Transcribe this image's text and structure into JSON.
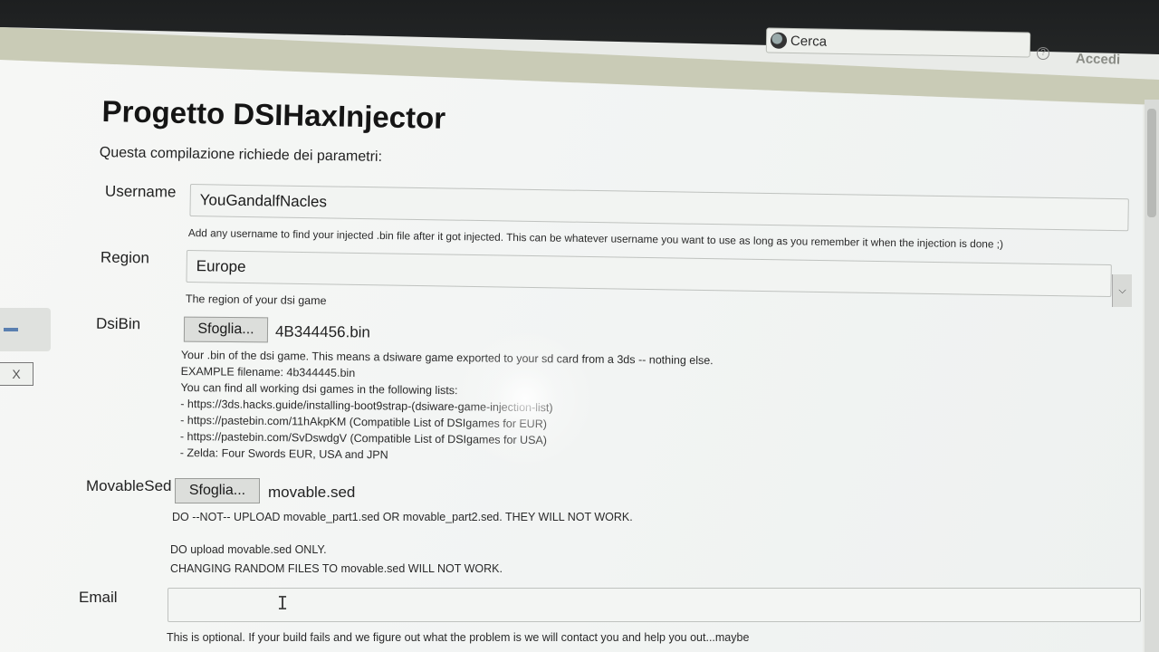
{
  "header": {
    "search_placeholder": "Cerca",
    "help_label": "?",
    "login_label": "Accedi"
  },
  "page": {
    "title": "Progetto DSIHaxInjector",
    "subtitle": "Questa compilazione richiede dei parametri:"
  },
  "form": {
    "username": {
      "label": "Username",
      "value": "YouGandalfNacles",
      "help": "Add any username to find your injected .bin file after it got injected. This can be whatever username you want to use as long as you remember it when the injection is done ;)"
    },
    "region": {
      "label": "Region",
      "value": "Europe",
      "help": "The region of your dsi game"
    },
    "dsibin": {
      "label": "DsiBin",
      "button": "Sfoglia...",
      "filename": "4B344456.bin",
      "help_lines": [
        "Your .bin of the dsi game. This means a dsiware game exported to your sd card from a 3ds -- nothing else.",
        "EXAMPLE filename: 4b344445.bin",
        "You can find all working dsi games in the following lists:",
        "- https://3ds.hacks.guide/installing-boot9strap-(dsiware-game-injection-list)",
        "- https://pastebin.com/11hAkpKM (Compatible List of DSIgames for EUR)",
        "- https://pastebin.com/SvDswdgV (Compatible List of DSIgames for USA)",
        "- Zelda: Four Swords EUR, USA and JPN"
      ]
    },
    "movablesed": {
      "label": "MovableSed",
      "button": "Sfoglia...",
      "filename": "movable.sed",
      "help_lines": [
        "DO --NOT-- UPLOAD movable_part1.sed OR movable_part2.sed. THEY WILL NOT WORK.",
        "DO upload movable.sed ONLY.",
        "CHANGING RANDOM FILES TO movable.sed WILL NOT WORK."
      ]
    },
    "email": {
      "label": "Email",
      "value": "",
      "help": "This is optional. If your build fails and we figure out what the problem is we will contact you and help you out...maybe"
    }
  },
  "side": {
    "close_label": "X"
  }
}
